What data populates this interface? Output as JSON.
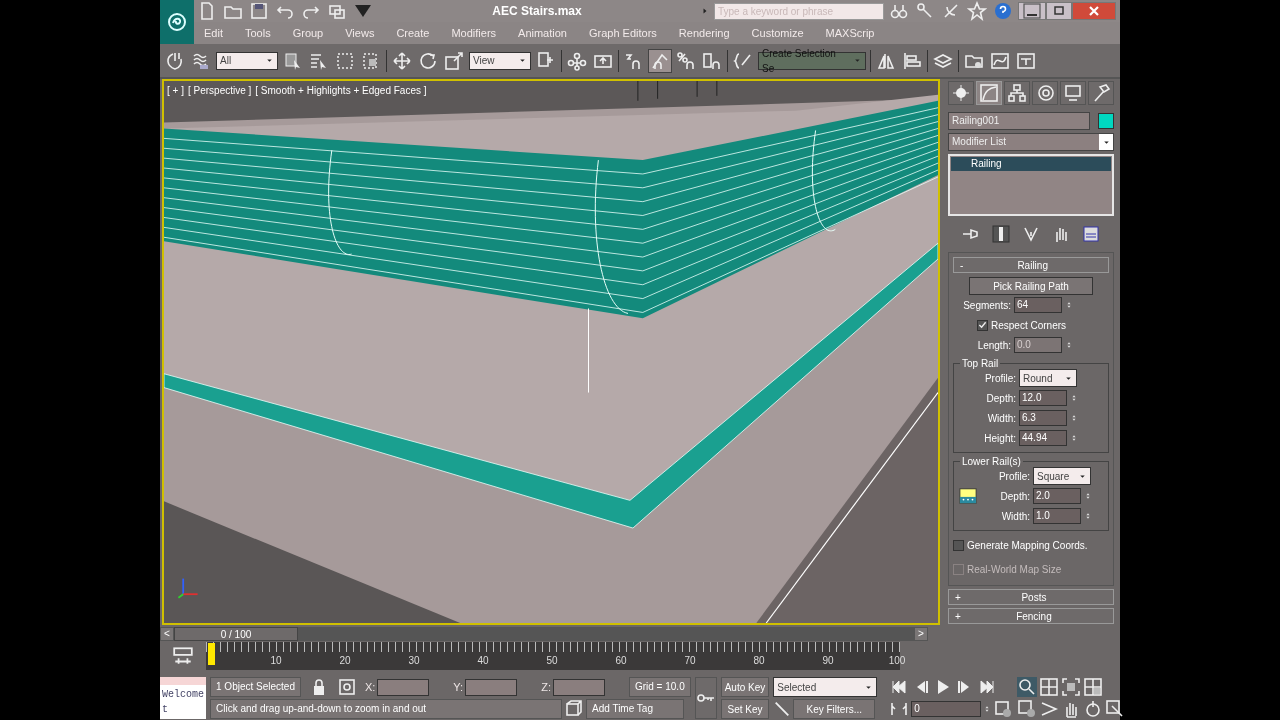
{
  "window": {
    "title": "AEC Stairs.max",
    "search": {
      "placeholder": "Type a keyword or phrase"
    }
  },
  "menu": [
    "Edit",
    "Tools",
    "Group",
    "Views",
    "Create",
    "Modifiers",
    "Animation",
    "Graph Editors",
    "Rendering",
    "Customize",
    "MAXScrip"
  ],
  "toolbar": {
    "selection_filter": "All",
    "reference_coordinate": "View",
    "named_selection": "Create Selection Se",
    "angle_snap_on": true
  },
  "viewport": {
    "labels": [
      "[ + ]",
      "[ Perspective ]",
      "[ Smooth + Highlights + Edged Faces ]"
    ],
    "active": true
  },
  "command_panel": {
    "tabs": [
      {
        "selected": false
      },
      {
        "selected": true
      },
      {
        "selected": false
      },
      {
        "selected": false
      },
      {
        "selected": false
      },
      {
        "selected": false
      }
    ],
    "object_name": "Railing001",
    "modifier_list": "Modifier List",
    "stack": [
      {
        "label": "Railing",
        "selected": true
      }
    ],
    "rollouts": [
      {
        "sign": "-",
        "title": "Railing",
        "expanded": true
      },
      {
        "sign": "+",
        "title": "Posts",
        "expanded": false
      },
      {
        "sign": "+",
        "title": "Fencing",
        "expanded": false
      }
    ],
    "railing": {
      "pick_button": "Pick Railing Path",
      "segments": {
        "label": "Segments:",
        "value": "64"
      },
      "respect_corners": {
        "label": "Respect Corners",
        "checked": true
      },
      "length": {
        "label": "Length:",
        "value": "0.0",
        "disabled": true
      },
      "top_rail": {
        "title": "Top Rail",
        "fields": [
          {
            "label": "Profile:",
            "value": "Round",
            "kind": "dropdown"
          },
          {
            "label": "Depth:",
            "value": "12.0",
            "kind": "spinner"
          },
          {
            "label": "Width:",
            "value": "6.3",
            "kind": "spinner"
          },
          {
            "label": "Height:",
            "value": "44.94",
            "kind": "spinner"
          }
        ]
      },
      "lower_rails": {
        "title": "Lower Rail(s)",
        "fields": [
          {
            "label": "Profile:",
            "value": "Square",
            "kind": "dropdown"
          },
          {
            "label": "Depth:",
            "value": "2.0",
            "kind": "spinner"
          },
          {
            "label": "Width:",
            "value": "1.0",
            "kind": "spinner"
          }
        ]
      },
      "options": [
        {
          "label": "Generate Mapping Coords.",
          "checked": false,
          "disabled": false
        },
        {
          "label": "Real-World Map Size",
          "checked": false,
          "disabled": true
        }
      ]
    }
  },
  "time_slider": {
    "prev": "<",
    "label": "0 / 100",
    "next": ">",
    "level": 0
  },
  "track_bar": {
    "ticks": [
      "10",
      "20",
      "30",
      "40",
      "50",
      "60",
      "70",
      "80",
      "90",
      "100"
    ]
  },
  "status": {
    "listener": "Welcome t",
    "selection": "1 Object Selected",
    "x_label": "X:",
    "y_label": "Y:",
    "z_label": "Z:",
    "grid": "Grid = 10.0",
    "prompt": "Click and drag up-and-down to zoom in and out",
    "time_tag": "Add Time Tag",
    "auto_key": "Auto Key",
    "set_key": "Set Key",
    "key_mode": "Selected",
    "key_filters": "Key Filters...",
    "frame": "0"
  }
}
